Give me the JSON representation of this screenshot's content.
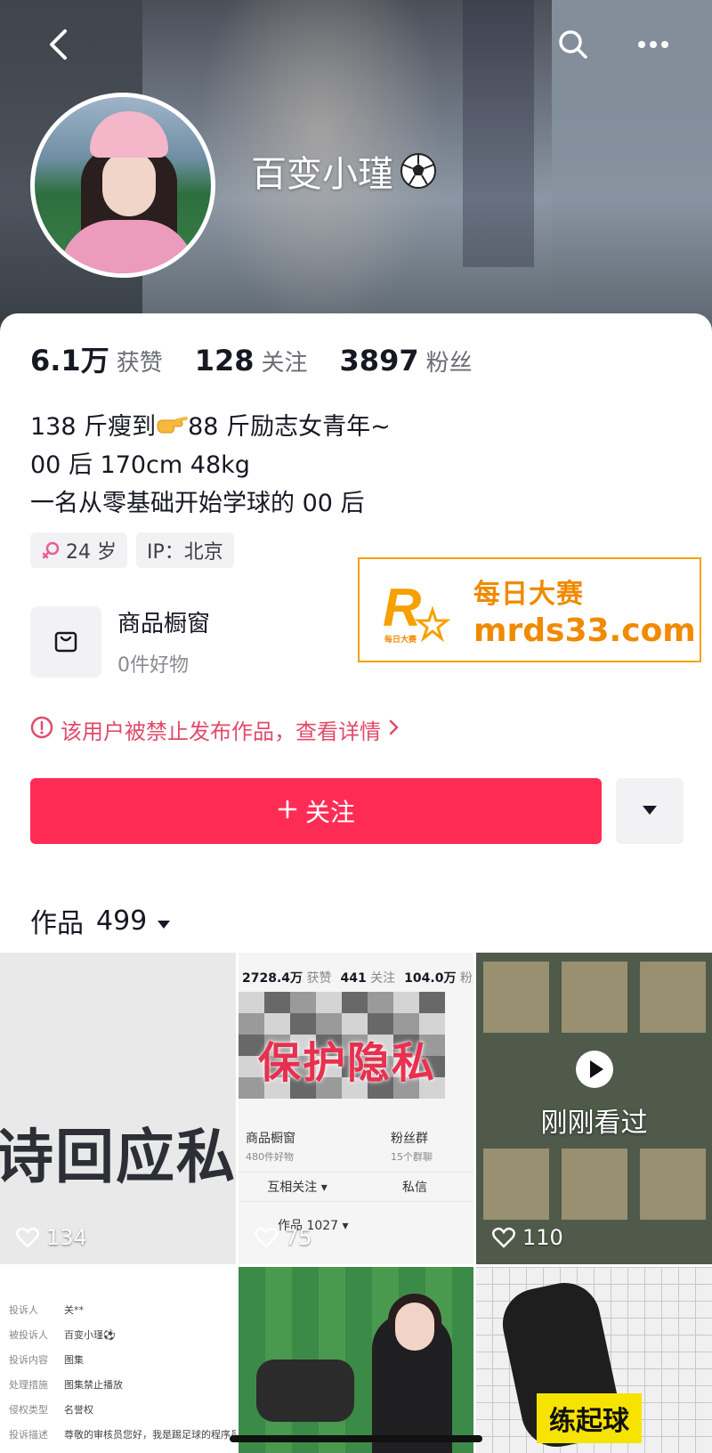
{
  "profile": {
    "username": "百变小瑾",
    "stats": [
      {
        "value": "6.1万",
        "label": "获赞"
      },
      {
        "value": "128",
        "label": "关注"
      },
      {
        "value": "3897",
        "label": "粉丝"
      }
    ],
    "bio": {
      "line1_a": "138 斤瘦到",
      "line1_b": "88 斤励志女青年~",
      "line2": "00 后 170cm 48kg",
      "line3": "一名从零基础开始学球的 00 后"
    },
    "tags": {
      "age": "24 岁",
      "ip": "IP：北京"
    },
    "shop": {
      "title": "商品橱窗",
      "subtitle": "0件好物"
    },
    "warning": "该用户被禁止发布作品，查看详情",
    "follow_label": "关注",
    "works_label": "作品",
    "works_count": "499"
  },
  "watermark": {
    "line1": "每日大赛",
    "line2": "mrds33.com",
    "logo_small": "每日大赛"
  },
  "grid": {
    "tile1": {
      "text": "诗回应私",
      "likes": "134"
    },
    "tile2": {
      "stat1_v": "2728.4万",
      "stat1_l": "获赞",
      "stat2_v": "441",
      "stat2_l": "关注",
      "stat3_v": "104.0万",
      "stat3_l": "粉丝",
      "title": "保护隐私",
      "shop_l": "商品橱窗",
      "shop_s": "480件好物",
      "fans_l": "粉丝群",
      "fans_s": "15个群聊",
      "mutual": "互相关注 ▾",
      "msg": "私信",
      "works": "作品 1027 ▾",
      "likes": "75"
    },
    "tile3": {
      "seen": "刚刚看过",
      "likes": "110"
    },
    "tile4": {
      "rows": [
        {
          "k": "投诉人",
          "v": "关**"
        },
        {
          "k": "被投诉人",
          "v": "百变小瑾⚽"
        },
        {
          "k": "投诉内容",
          "v": "图集"
        },
        {
          "k": "处理措施",
          "v": "图集禁止播放"
        },
        {
          "k": "侵权类型",
          "v": "名誉权"
        },
        {
          "k": "投诉描述",
          "v": "尊敬的审核员您好，我是踢足球的程序员"
        }
      ]
    },
    "tile6": {
      "badge": "练起球"
    }
  },
  "colors": {
    "accent": "#fe2c55",
    "warning": "#e24a6b",
    "watermark": "#f08a00"
  }
}
